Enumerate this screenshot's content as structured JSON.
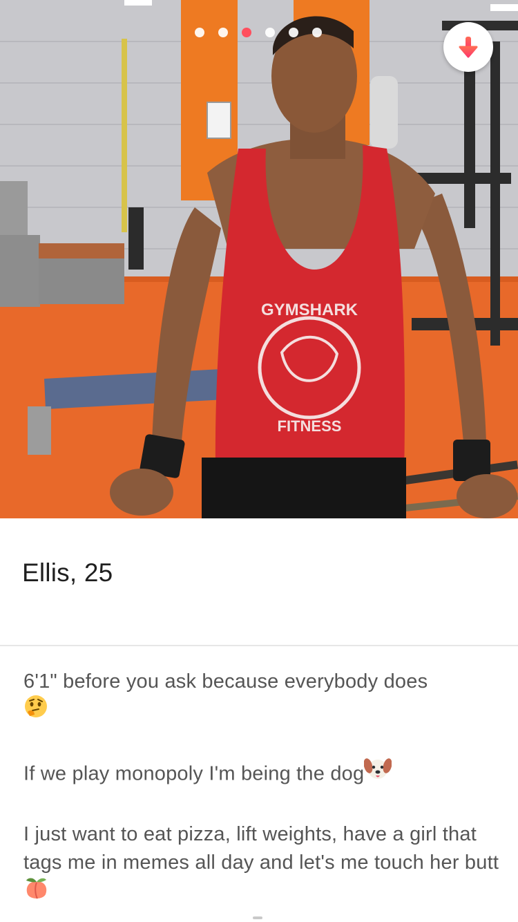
{
  "profile": {
    "name": "Ellis",
    "separator": ", ",
    "age": "25",
    "photo_count": 6,
    "active_photo_index": 2,
    "shirt_text_top": "GYMSHARK",
    "shirt_text_bottom": "FITNESS"
  },
  "info_button": {
    "icon": "down-arrow-icon"
  },
  "bio": {
    "line1": "6'1\" before you ask because everybody does",
    "line1_emoji": "thinking-face-icon",
    "line2": "If we play monopoly I'm being the dog",
    "line2_emoji": "dog-face-icon",
    "line3": "I just want to eat pizza, lift weights, have a girl that tags me in memes all day and let's me touch her butt",
    "line3_emoji": "peach-icon"
  },
  "colors": {
    "accent": "#ff4f5e",
    "text_primary": "#1f1f1f",
    "text_secondary": "#555555",
    "divider": "#e6e6e6"
  }
}
